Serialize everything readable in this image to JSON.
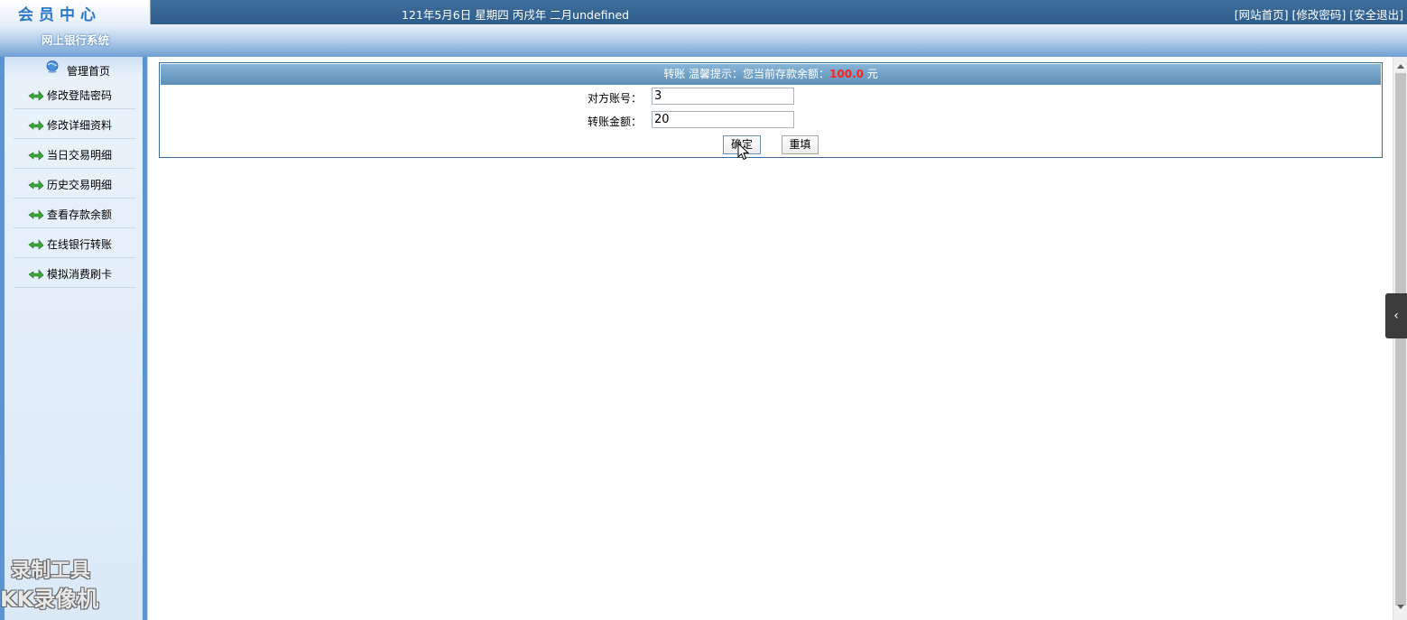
{
  "header": {
    "logo_text": "会员中心",
    "date_text": "121年5月6日 星期四 丙戌年 二月undefined",
    "links": {
      "home": "[网站首页]",
      "change_password": "[修改密码]",
      "logout": "[安全退出]"
    }
  },
  "banner": {
    "title": "网上银行系统"
  },
  "sidebar": {
    "home_label": "管理首页",
    "items": [
      {
        "label": "修改登陆密码"
      },
      {
        "label": "修改详细资料"
      },
      {
        "label": "当日交易明细"
      },
      {
        "label": "历史交易明细"
      },
      {
        "label": "查看存款余额"
      },
      {
        "label": "在线银行转账"
      },
      {
        "label": "模拟消费刷卡"
      }
    ]
  },
  "panel": {
    "title_prefix": "转账 温馨提示：您当前存款余额：",
    "balance": "100.0",
    "unit": " 元",
    "account_label": "对方账号：",
    "account_value": "3",
    "amount_label": "转账金额：",
    "amount_value": "20",
    "confirm_label": "确定",
    "reset_label": "重填"
  },
  "watermark": {
    "line1": "录制工具",
    "line2": "KK录像机"
  },
  "colors": {
    "topbar": "#2e5c8a",
    "accent_red": "#ff2020",
    "sidebar_frame": "#5e93d1"
  }
}
